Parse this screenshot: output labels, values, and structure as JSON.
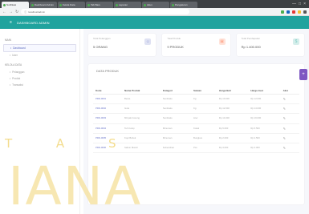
{
  "browser": {
    "tabs": [
      "Notifikasi",
      "Dashboard Admin",
      "Kelola Data",
      "Tab Baru",
      "Laporan",
      "Akun",
      "Pengaturan"
    ],
    "active_tab_index": 0,
    "url": "localhost/admin",
    "window_controls": [
      "—",
      "□",
      "×"
    ]
  },
  "topbar": {
    "title": "DASHBOARD ADMIN"
  },
  "sidebar": {
    "sections": [
      {
        "title": "Main",
        "items": [
          {
            "label": "Dashboard",
            "active": true
          },
          {
            "label": "User",
            "active": false
          }
        ]
      },
      {
        "title": "Kelola Data",
        "items": [
          {
            "label": "Pelanggan",
            "active": false
          },
          {
            "label": "Produk",
            "active": false
          },
          {
            "label": "Transaksi",
            "active": false
          }
        ]
      }
    ]
  },
  "cards": [
    {
      "label": "Total Pelanggan",
      "value": "5 ORANG",
      "icon": "user-icon",
      "icon_char": "☺",
      "color": "#9fa8da"
    },
    {
      "label": "Total Produk",
      "value": "9 PRODUK",
      "icon": "box-icon",
      "icon_char": "▣",
      "color": "#ffab91"
    },
    {
      "label": "Total Pendapatan",
      "value": "Rp 1.400.000",
      "icon": "money-icon",
      "icon_char": "$",
      "color": "#80cbc4"
    }
  ],
  "panel": {
    "title": "DATA PRODUK",
    "fab_label": "+",
    "columns": [
      "Kode",
      "Nama Produk",
      "Kategori",
      "Satuan",
      "Harga Beli",
      "Harga Jual",
      "Aksi"
    ],
    "rows": [
      [
        "PRD-0001",
        "Beras",
        "Sembako",
        "Kg",
        "Rp 10.000",
        "Rp 12.000",
        "✎"
      ],
      [
        "PRD-0002",
        "Gula",
        "Sembako",
        "Kg",
        "Rp 12.000",
        "Rp 14.000",
        "✎"
      ],
      [
        "PRD-0003",
        "Minyak Goreng",
        "Sembako",
        "Liter",
        "Rp 14.000",
        "Rp 16.000",
        "✎"
      ],
      [
        "PRD-0004",
        "Teh Celup",
        "Minuman",
        "Kotak",
        "Rp 5.000",
        "Rp 6.500",
        "✎"
      ],
      [
        "PRD-0005",
        "Kopi Bubuk",
        "Minuman",
        "Bungkus",
        "Rp 2.000",
        "Rp 2.500",
        "✎"
      ],
      [
        "PRD-0006",
        "Sabun Mandi",
        "Kebersihan",
        "Pcs",
        "Rp 3.000",
        "Rp 4.000",
        "✎"
      ]
    ]
  },
  "watermark": {
    "line1": "T A S",
    "line2": "IANA"
  }
}
